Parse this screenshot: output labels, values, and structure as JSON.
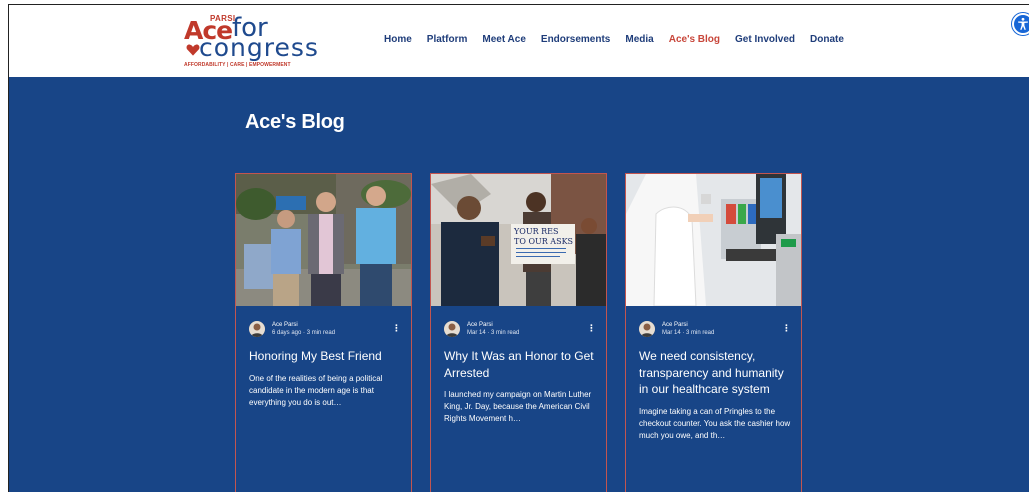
{
  "logo": {
    "parsi": "PARSI",
    "ace": "Ace",
    "for": "for",
    "congress": "congress",
    "tagline": "AFFORDABILITY | CARE | EMPOWERMENT"
  },
  "nav": {
    "items": [
      {
        "label": "Home"
      },
      {
        "label": "Platform"
      },
      {
        "label": "Meet Ace"
      },
      {
        "label": "Endorsements"
      },
      {
        "label": "Media"
      },
      {
        "label": "Ace's Blog",
        "active": true
      },
      {
        "label": "Get Involved"
      },
      {
        "label": "Donate"
      }
    ]
  },
  "page": {
    "title": "Ace's Blog"
  },
  "posts": [
    {
      "author": "Ace Parsi",
      "date": "6 days ago  ·  3 min read",
      "title": "Honoring My Best Friend",
      "excerpt": "One of the realities of being a political candidate in the modern age is that everything you do is out…"
    },
    {
      "author": "Ace Parsi",
      "date": "Mar 14  ·  3 min read",
      "title": "Why It Was an Honor to Get Arrested",
      "excerpt": "I launched my campaign on Martin Luther King, Jr. Day, because the American Civil Rights Movement h…",
      "sign_text": "YOUR RES... TO OUR ASKS"
    },
    {
      "author": "Ace Parsi",
      "date": "Mar 14  ·  3 min read",
      "title": "We need consistency, transparency and humanity in our healthcare system",
      "excerpt": "Imagine taking a can of Pringles to the checkout counter. You ask the cashier how much you owe, and th…"
    }
  ],
  "colors": {
    "brand_red": "#c0392b",
    "brand_blue": "#1f4a8e",
    "page_bg": "#184587",
    "card_border": "#c25550",
    "accessibility_blue": "#1766d6"
  }
}
